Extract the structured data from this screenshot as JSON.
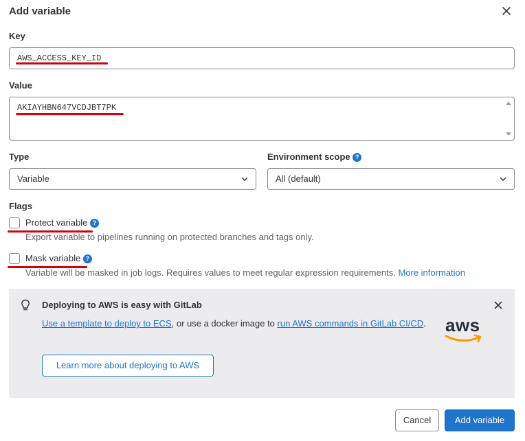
{
  "dialog": {
    "title": "Add variable"
  },
  "key": {
    "label": "Key",
    "value": "AWS_ACCESS_KEY_ID"
  },
  "value_field": {
    "label": "Value",
    "value": "AKIAYHBN647VCDJBT7PK"
  },
  "type": {
    "label": "Type",
    "selected": "Variable"
  },
  "environment_scope": {
    "label": "Environment scope",
    "selected": "All (default)"
  },
  "flags": {
    "label": "Flags",
    "protect": {
      "label": "Protect variable",
      "help": "Export variable to pipelines running on protected branches and tags only."
    },
    "mask": {
      "label": "Mask variable",
      "help": "Variable will be masked in job logs. Requires values to meet regular expression requirements.",
      "link": "More information"
    }
  },
  "aws_alert": {
    "title": "Deploying to AWS is easy with GitLab",
    "link1": "Use a template to deploy to ECS",
    "text1": ", or use a docker image to ",
    "link2": "run AWS commands in GitLab CI/CD",
    "text2": ".",
    "button": "Learn more about deploying to AWS",
    "logo_text": "aws"
  },
  "footer": {
    "cancel": "Cancel",
    "submit": "Add variable"
  },
  "colors": {
    "accent": "#1f75cb",
    "annotation": "#d4000b",
    "alert_bg": "#ececef"
  }
}
